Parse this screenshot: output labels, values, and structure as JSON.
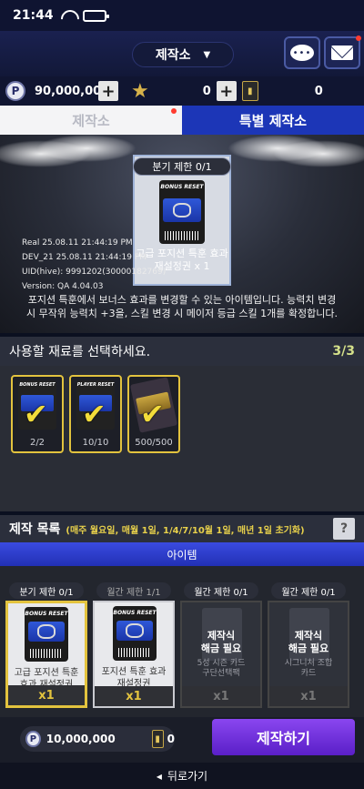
{
  "status": {
    "time": "21:44"
  },
  "header": {
    "title": "제작소",
    "chat_icon_text": "•••"
  },
  "currency": {
    "points": "90,000,000",
    "stars": "0",
    "tokens": "0",
    "coin_symbol": "P"
  },
  "tabs": [
    {
      "label": "제작소"
    },
    {
      "label": "특별 제작소"
    }
  ],
  "preview": {
    "limit": "분기 제한 0/1",
    "card_name_line1": "고급 포지션 특훈 효과",
    "card_name_line2": "재설정권 x 1",
    "ticket_label": "BONUS RESET",
    "debug_real": "Real    25.08.11 21:44:19 PM",
    "debug_dev": "DEV_21   25.08.11 21:44:19 PM",
    "debug_uid": "UID(hive): 9991202(30000182769)",
    "debug_version": "Version: QA 4.04.03",
    "description": "포지션 특훈에서 보너스 효과를 변경할 수 있는 아이템입니다. 능력치 변경 시 무작위 능력치 +3을, 스킬 변경 시 메이저 등급 스킬 1개를 확정합니다."
  },
  "materials": {
    "heading": "사용할 재료를 선택하세요.",
    "count": "3/3",
    "slots": [
      {
        "label": "BONUS RESET",
        "qty": "2/2"
      },
      {
        "label": "PLAYER RESET",
        "qty": "10/10"
      },
      {
        "label": "",
        "qty": "500/500"
      }
    ]
  },
  "production": {
    "heading": "제작 목록",
    "schedule": "(매주 월요일, 매월 1일, 1/4/7/10월 1일, 매년 1일 초기화)",
    "help": "?",
    "category": "아이템",
    "cards": [
      {
        "limit": "분기 제한 0/1",
        "name1": "고급 포지션 특훈",
        "name2": "효과 재설정권",
        "qty": "x1"
      },
      {
        "limit": "월간 제한 1/1",
        "name1": "포지션 특훈 효과",
        "name2": "재설정권",
        "qty": "x1"
      },
      {
        "limit": "월간 제한 0/1",
        "lock1": "제작식",
        "lock2": "해금 필요",
        "sub1": "5성 시즌 카드",
        "sub2": "구단선택팩",
        "qty": "x1"
      },
      {
        "limit": "월간 제한 0/1",
        "lock1": "제작식",
        "lock2": "해금 필요",
        "sub1": "시그니처 조합",
        "sub2": "카드",
        "qty": "x1"
      }
    ]
  },
  "bottom": {
    "cost": "10,000,000",
    "token_cost": "0",
    "make_label": "제작하기"
  },
  "back": {
    "label": "뒤로가기",
    "arrow": "◂"
  }
}
